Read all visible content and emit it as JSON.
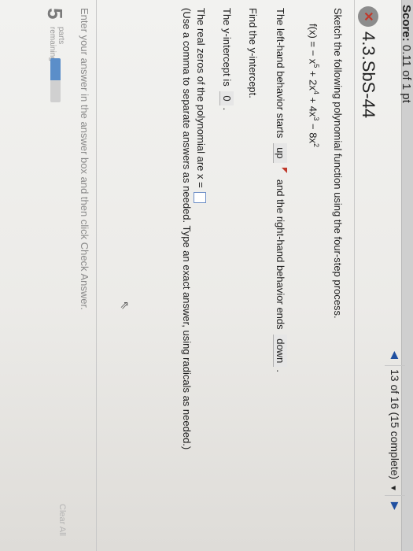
{
  "header": {
    "score_label": "Score:",
    "score_value": "0.11 of 1 pt",
    "position": "13 of 16 (15 complete)",
    "prev_icon": "triangle-left-icon",
    "next_icon": "triangle-right-icon"
  },
  "question": {
    "status_icon": "x-mark-icon",
    "title": "4.3.SbS-44",
    "prompt": "Sketch the following polynomial function using the four-step process.",
    "function": {
      "prefix": "f(x) = − x",
      "e1": "5",
      "t2": " + 2x",
      "e2": "4",
      "t3": " + 4x",
      "e3": "3",
      "t4": " − 8x",
      "e4": "2"
    },
    "behavior": {
      "before": "The left-hand behavior starts",
      "left_answer": "up",
      "middle": "and the right-hand behavior ends",
      "right_answer": "down",
      "after": "."
    },
    "find_intercept": "Find the y-intercept.",
    "intercept": {
      "text": "The y-intercept is",
      "answer": "0",
      "after": "."
    },
    "zeros": {
      "text": "The real zeros of the polynomial are x =",
      "value": ""
    },
    "zeros_hint": "(Use a comma to separate answers as needed. Type an exact answer, using radicals as needed.)"
  },
  "footer": {
    "instruction": "Enter your answer in the answer box and then click Check Answer.",
    "parts_count": "5",
    "parts_line1": "parts",
    "parts_line2": "remaining",
    "progress_fraction": 0.5,
    "clear_label": "Clear All"
  }
}
